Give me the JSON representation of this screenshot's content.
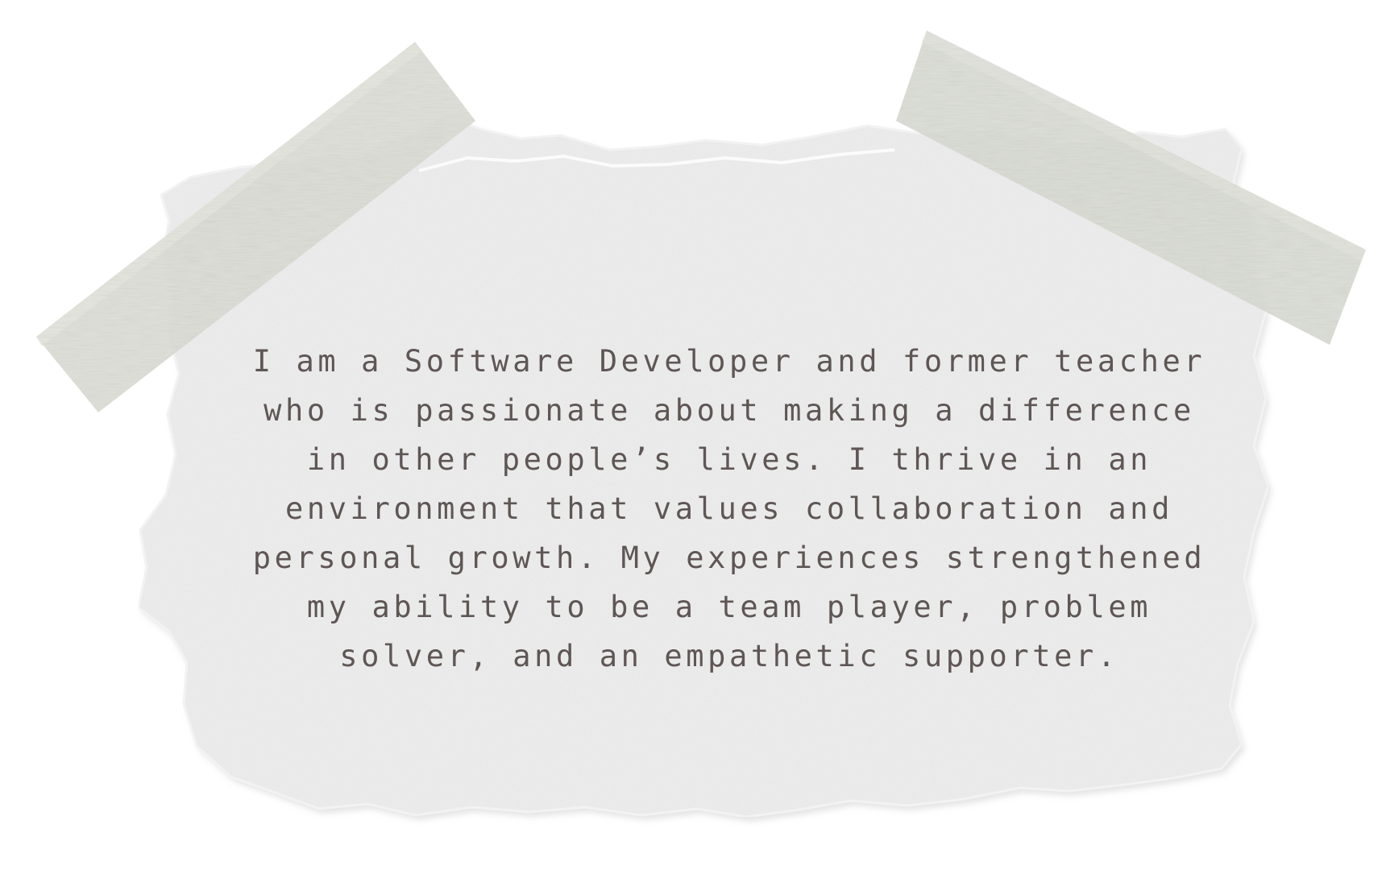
{
  "note": {
    "lines": [
      "I am a Software Developer and former teacher",
      "who is passionate about making a difference",
      "in other people’s lives. I thrive in an",
      "environment that values collaboration and",
      "personal growth. My experiences strengthened",
      "my ability to be a team player, problem",
      "solver, and an empathetic supporter."
    ]
  },
  "colors": {
    "background": "#ffffff",
    "paper": "#eeeeee",
    "tape": "#d9dbd3",
    "text": "#5e5655"
  }
}
